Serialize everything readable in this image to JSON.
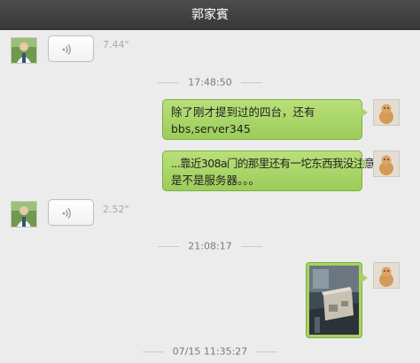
{
  "window": {
    "title": "郭家賓"
  },
  "messages": {
    "voice_1": {
      "duration": "7.44\""
    },
    "time_1": "17:48:50",
    "text_1": {
      "line1": "除了刚才提到过的四台，还有",
      "line2": "bbs,server345"
    },
    "text_2": {
      "line1": "...靠近308a门的那里还有一坨东西我没注意",
      "line2": "是不是服务器。。。"
    },
    "voice_2": {
      "duration": "2.52\""
    },
    "time_2": "21:08:17",
    "time_3": "07/15 11:35:27"
  },
  "icons": {
    "voice": "sound-wave-icon",
    "contact_avatar": "contact-avatar",
    "self_avatar": "self-avatar"
  },
  "colors": {
    "title_bar": "#3f3f3f",
    "chat_background": "#ececec",
    "sent_bubble": "#a7d163",
    "timestamp_text": "#7a7a7a"
  }
}
